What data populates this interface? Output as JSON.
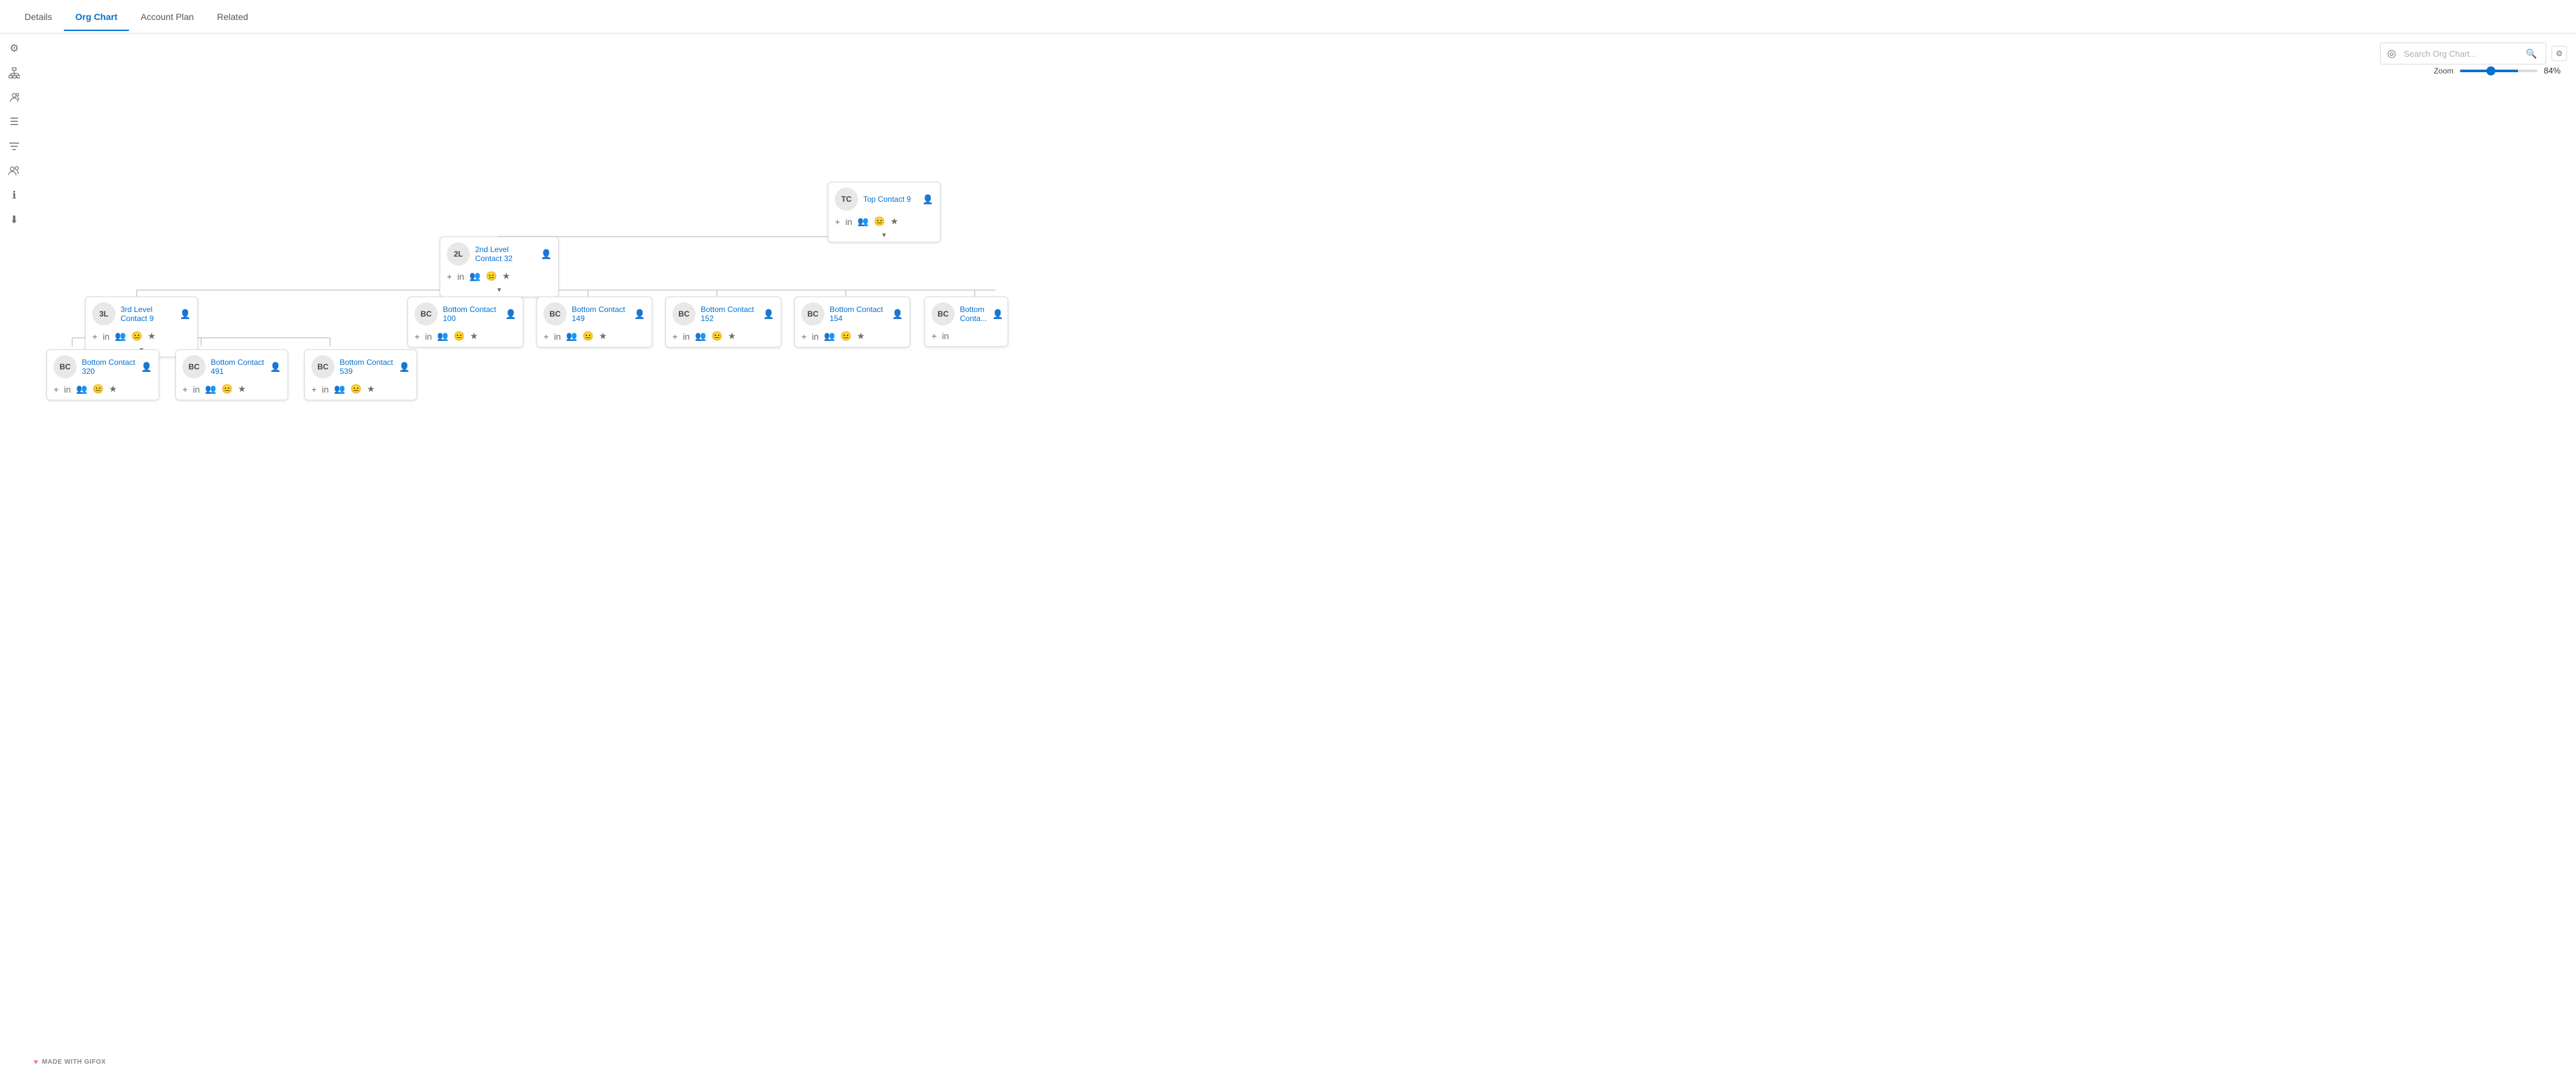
{
  "tabs": [
    {
      "label": "Details",
      "active": false
    },
    {
      "label": "Org Chart",
      "active": true
    },
    {
      "label": "Account Plan",
      "active": false
    },
    {
      "label": "Related",
      "active": false
    }
  ],
  "sidebar": {
    "icons": [
      {
        "name": "gear-icon",
        "symbol": "⚙"
      },
      {
        "name": "hierarchy-icon",
        "symbol": "🏢"
      },
      {
        "name": "group-icon",
        "symbol": "👥"
      },
      {
        "name": "list-icon",
        "symbol": "☰"
      },
      {
        "name": "filter-icon",
        "symbol": "⧩"
      },
      {
        "name": "people-icon",
        "symbol": "👤"
      },
      {
        "name": "info-icon",
        "symbol": "ℹ"
      },
      {
        "name": "download-icon",
        "symbol": "⬇"
      }
    ]
  },
  "search": {
    "placeholder": "Search Org Chart...",
    "value": ""
  },
  "zoom": {
    "label": "Zoom",
    "value": 84,
    "display": "84%"
  },
  "nodes": {
    "top_contact_9": {
      "initials": "TC",
      "name": "Top Contact 9",
      "avatar_bg": "#e8e8e8"
    },
    "level2_contact_32": {
      "initials": "2L",
      "name": "2nd Level Contact 32",
      "avatar_bg": "#e8e8e8"
    },
    "level3_contact_9": {
      "initials": "3L",
      "name": "3rd Level Contact 9",
      "avatar_bg": "#e8e8e8"
    },
    "bottom_100": {
      "initials": "BC",
      "name": "Bottom Contact 100",
      "avatar_bg": "#e8e8e8"
    },
    "bottom_149": {
      "initials": "BC",
      "name": "Bottom Contact 149",
      "avatar_bg": "#e8e8e8"
    },
    "bottom_152": {
      "initials": "BC",
      "name": "Bottom Contact 152",
      "avatar_bg": "#e8e8e8"
    },
    "bottom_154": {
      "initials": "BC",
      "name": "Bottom Contact 154",
      "avatar_bg": "#e8e8e8"
    },
    "bottom_last": {
      "initials": "BC",
      "name": "Bottom Conta...",
      "avatar_bg": "#e8e8e8"
    },
    "bottom_320": {
      "initials": "BC",
      "name": "Bottom Contact 320",
      "avatar_bg": "#e8e8e8"
    },
    "bottom_491": {
      "initials": "BC",
      "name": "Bottom Contact 491",
      "avatar_bg": "#e8e8e8"
    },
    "bottom_539": {
      "initials": "BC",
      "name": "Bottom Contact 539",
      "avatar_bg": "#e8e8e8"
    }
  },
  "watermark": {
    "text": "MADE WITH GIFOX",
    "heart": "♥"
  }
}
